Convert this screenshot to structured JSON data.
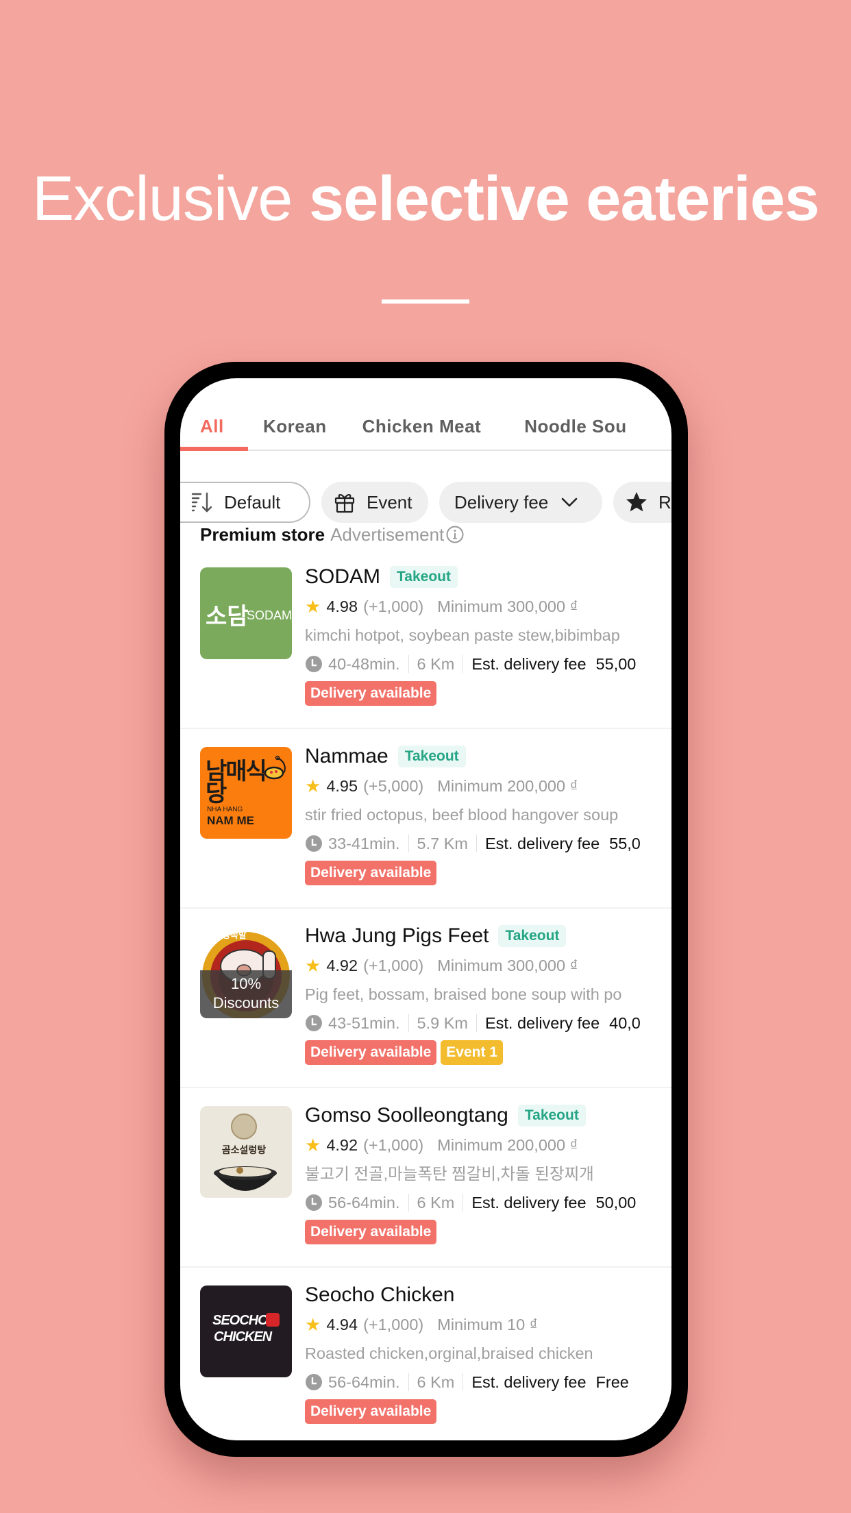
{
  "headline": {
    "light": "Exclusive",
    "bold": "selective eateries"
  },
  "tabs": [
    {
      "label": "All",
      "active": true
    },
    {
      "label": "Korean",
      "active": false
    },
    {
      "label": "Chicken Meat",
      "active": false
    },
    {
      "label": "Noodle Soup",
      "active": false
    }
  ],
  "tabs_visible": {
    "noodle_truncated": "Noodle Sou"
  },
  "filters": {
    "sort": {
      "label": "Default",
      "icon": "sort-descending-icon"
    },
    "event": {
      "label": "Event",
      "icon": "gift-icon"
    },
    "delivery_fee": {
      "label": "Delivery fee",
      "icon": "chevron-down-icon"
    },
    "rating": {
      "label": "R",
      "icon": "star-icon"
    }
  },
  "section": {
    "title": "Premium store",
    "subtitle": "Advertisement",
    "icon": "info-icon"
  },
  "colors": {
    "background": "#F4A59D",
    "accent": "#F26B5E",
    "takeout_text": "#25A585",
    "takeout_bg": "#E9F8F4",
    "delivery_tag": "#F2726A",
    "event_tag": "#F2BC2E",
    "star": "#F8BE1B"
  },
  "stores": [
    {
      "name": "SODAM",
      "takeout": "Takeout",
      "rating": "4.98",
      "review_count": "(+1,000)",
      "minimum": "Minimum 300,000 ₫",
      "description": "kimchi hotpot, soybean paste stew,bibimbap",
      "time": "40-48min.",
      "distance": "6 Km",
      "fee_label": "Est. delivery fee",
      "fee_value": "55,00",
      "tags": [
        "Delivery available"
      ],
      "logo": {
        "korean": "소담",
        "latin": "SODAM",
        "bg": "#7BAA5C"
      }
    },
    {
      "name": "Nammae",
      "takeout": "Takeout",
      "rating": "4.95",
      "review_count": "(+5,000)",
      "minimum": "Minimum 200,000 ₫",
      "description": "stir fried octopus, beef blood hangover soup",
      "time": "33-41min.",
      "distance": "5.7 Km",
      "fee_label": "Est. delivery fee",
      "fee_value": "55,0",
      "tags": [
        "Delivery available"
      ],
      "logo": {
        "korean": "남매식당",
        "small": "NHA HANG",
        "latin": "NAM ME",
        "bg": "#FB7D0E"
      }
    },
    {
      "name": "Hwa Jung Pigs Feet",
      "takeout": "Takeout",
      "rating": "4.92",
      "review_count": "(+1,000)",
      "minimum": "Minimum 300,000 ₫",
      "description": "Pig feet, bossam, braised bone soup with po",
      "time": "43-51min.",
      "distance": "5.9 Km",
      "fee_label": "Est. delivery fee",
      "fee_value": "40,0",
      "tags": [
        "Delivery available",
        "Event 1"
      ],
      "logo": {
        "korean": "화정족발",
        "discount_pct": "10%",
        "discount_label": "Discounts"
      }
    },
    {
      "name": "Gomso Soolleongtang",
      "takeout": "Takeout",
      "rating": "4.92",
      "review_count": "(+1,000)",
      "minimum": "Minimum 200,000 ₫",
      "description": "불고기 전골,마늘폭탄 찜갈비,차돌 된장찌개",
      "time": "56-64min.",
      "distance": "6 Km",
      "fee_label": "Est. delivery fee",
      "fee_value": "50,00",
      "tags": [
        "Delivery available"
      ],
      "logo": {
        "korean": "곰소설렁탕"
      }
    },
    {
      "name": "Seocho Chicken",
      "takeout": "",
      "rating": "4.94",
      "review_count": "(+1,000)",
      "minimum": "Minimum 10 ₫",
      "description": "Roasted chicken,orginal,braised chicken",
      "time": "56-64min.",
      "distance": "6 Km",
      "fee_label": "Est. delivery fee",
      "fee_value": "Free",
      "tags": [
        "Delivery available"
      ],
      "logo": {
        "line1": "SEOCHO",
        "line2": "CHICKEN",
        "bg": "#221C22"
      }
    }
  ]
}
